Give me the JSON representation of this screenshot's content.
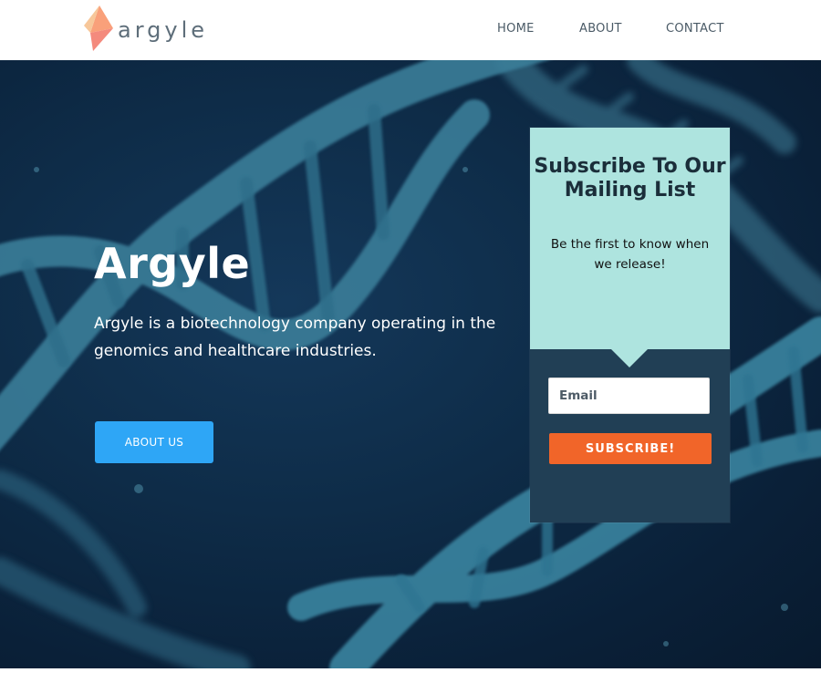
{
  "brand": {
    "name": "argyle",
    "accent_colors": [
      "#f9a07a",
      "#f7c79a",
      "#f48a7d"
    ]
  },
  "nav": {
    "items": [
      {
        "label": "HOME"
      },
      {
        "label": "ABOUT"
      },
      {
        "label": "CONTACT"
      }
    ]
  },
  "hero": {
    "title": "Argyle",
    "description": "Argyle is a biotechnology company operating in the genomics and healthcare industries.",
    "cta_label": "ABOUT US",
    "cta_color": "#2ea6f6",
    "background_color": "#0e2c48"
  },
  "subscribe": {
    "heading": "Subscribe To Our Mailing List",
    "subtext": "Be the first to know when we release!",
    "email_placeholder": "Email",
    "button_label": "SUBSCRIBE!",
    "top_color": "#aee4df",
    "panel_color": "#213f55",
    "button_color": "#f16529"
  }
}
